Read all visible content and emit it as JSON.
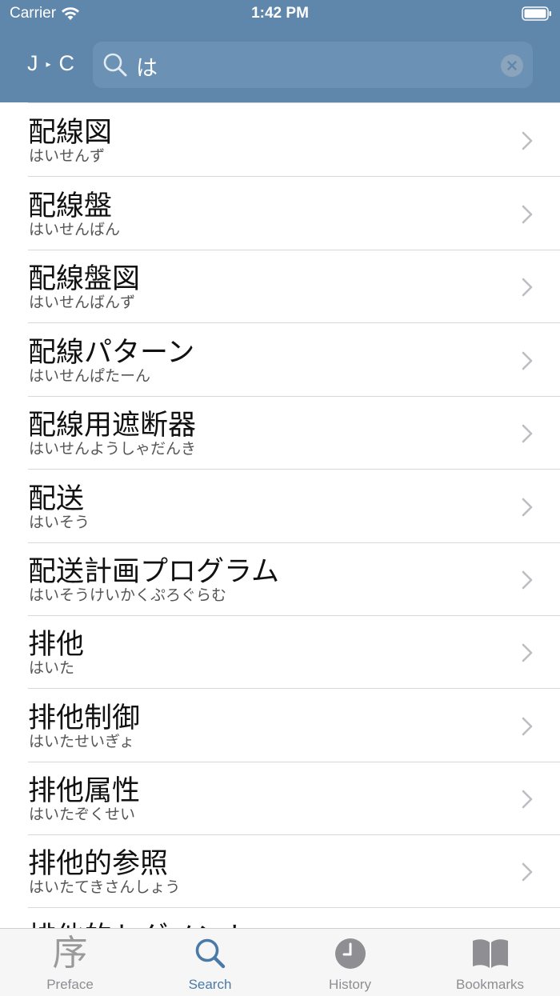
{
  "status_bar": {
    "carrier": "Carrier",
    "time": "1:42 PM"
  },
  "header": {
    "mode_from": "J",
    "mode_to": "C",
    "search": {
      "value": "は",
      "placeholder": ""
    }
  },
  "results": [
    {
      "word": "配線図",
      "reading": "はいせんず"
    },
    {
      "word": "配線盤",
      "reading": "はいせんばん"
    },
    {
      "word": "配線盤図",
      "reading": "はいせんばんず"
    },
    {
      "word": "配線パターン",
      "reading": "はいせんぱたーん"
    },
    {
      "word": "配線用遮断器",
      "reading": "はいせんようしゃだんき"
    },
    {
      "word": "配送",
      "reading": "はいそう"
    },
    {
      "word": "配送計画プログラム",
      "reading": "はいそうけいかくぷろぐらむ"
    },
    {
      "word": "排他",
      "reading": "はいた"
    },
    {
      "word": "排他制御",
      "reading": "はいたせいぎょ"
    },
    {
      "word": "排他属性",
      "reading": "はいたぞくせい"
    },
    {
      "word": "排他的参照",
      "reading": "はいたてきさんしょう"
    },
    {
      "word": "排他的セグメント",
      "reading": ""
    }
  ],
  "tabs": [
    {
      "label": "Preface",
      "icon": "preface-icon",
      "glyph": "序"
    },
    {
      "label": "Search",
      "icon": "search-icon"
    },
    {
      "label": "History",
      "icon": "clock-icon"
    },
    {
      "label": "Bookmarks",
      "icon": "book-icon"
    }
  ],
  "active_tab": "Search",
  "colors": {
    "header": "#5f87ab",
    "accent": "#4a7aa8",
    "inactive": "#8e8e93"
  }
}
